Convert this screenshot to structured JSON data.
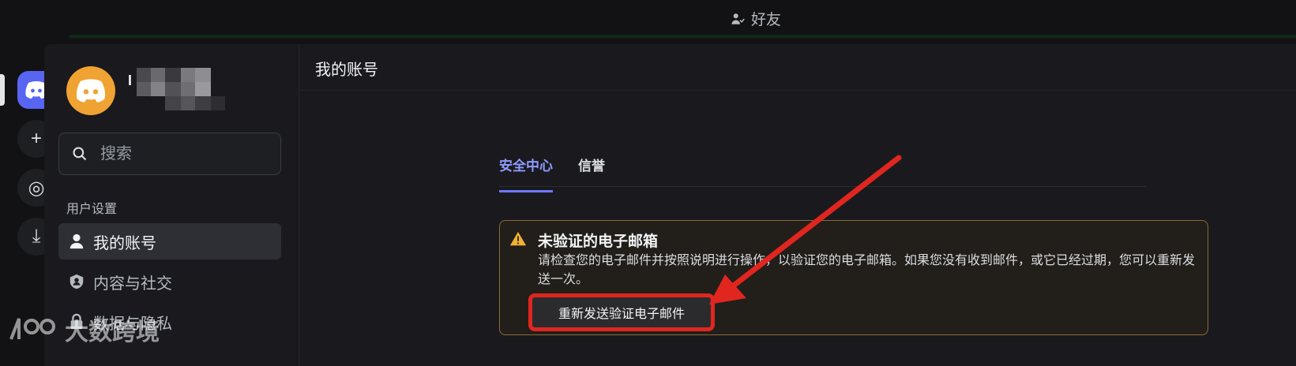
{
  "topbar": {
    "title": "好友"
  },
  "user": {
    "name_initial": "I"
  },
  "search": {
    "placeholder": "搜索"
  },
  "sidebar": {
    "section_label": "用户设置",
    "items": [
      {
        "label": "我的账号",
        "active": true
      },
      {
        "label": "内容与社交",
        "active": false
      },
      {
        "label": "数据与隐私",
        "active": false
      }
    ]
  },
  "main": {
    "title": "我的账号",
    "tabs": [
      {
        "label": "安全中心",
        "active": true
      },
      {
        "label": "信誉",
        "active": false
      }
    ],
    "alert": {
      "title": "未验证的电子邮箱",
      "body": "请检查您的电子邮件并按照说明进行操作，以验证您的电子邮箱。如果您没有收到邮件，或它已经过期，您可以重新发送一次。",
      "button_label": "重新发送验证电子邮件"
    }
  },
  "watermark": {
    "text": "大数跨境"
  },
  "colors": {
    "accent": "#6d78ff",
    "avatar": "#f0a232",
    "warning_border": "#8a6a34",
    "annotation_red": "#e0261f"
  }
}
